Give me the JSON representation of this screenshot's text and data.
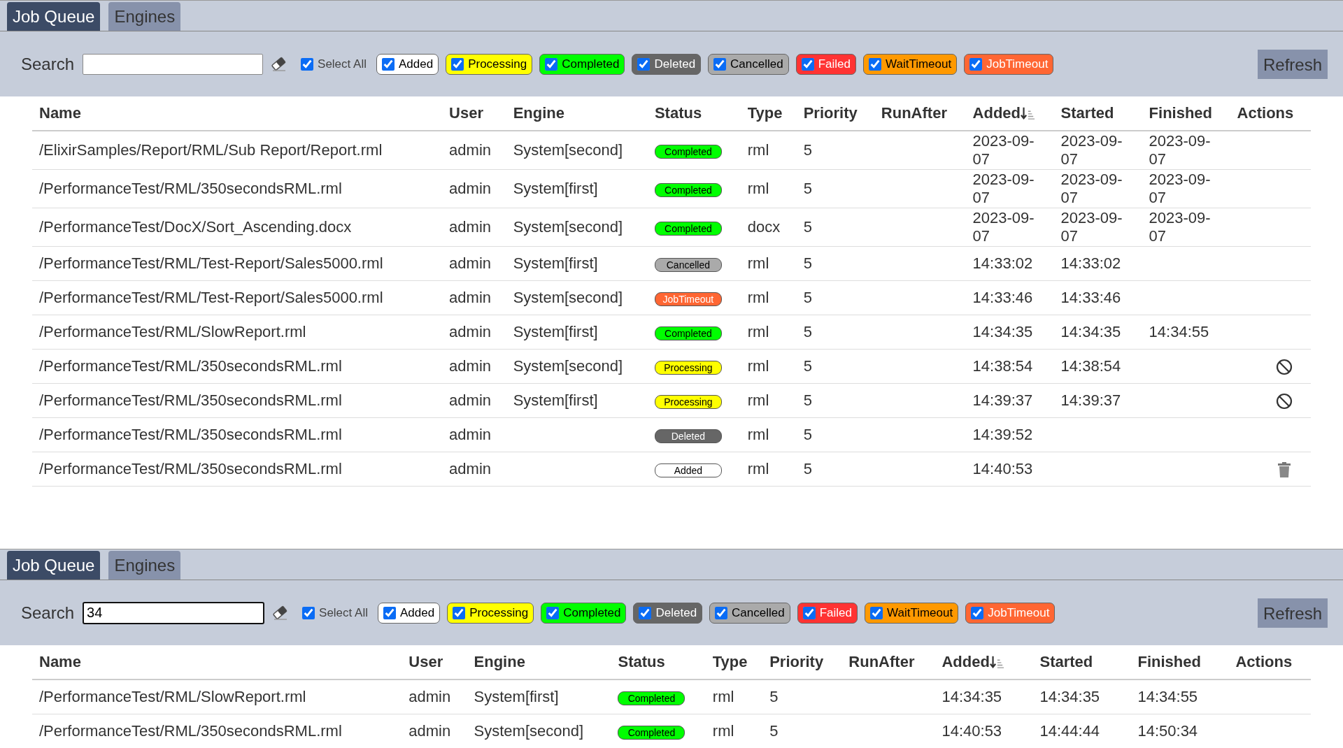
{
  "panels": [
    {
      "tabs": [
        {
          "label": "Job Queue",
          "selected": true
        },
        {
          "label": "Engines",
          "selected": false
        }
      ],
      "search": {
        "label": "Search"
      },
      "select_all": {
        "label": "Select All",
        "checked": true
      },
      "filters": [
        {
          "label": "Added",
          "checked": true,
          "color": "#ffffff"
        },
        {
          "label": "Processing",
          "checked": true,
          "color": "#ffff00"
        },
        {
          "label": "Completed",
          "checked": true,
          "color": "#00ff00"
        },
        {
          "label": "Deleted",
          "checked": true,
          "color": "#666666"
        },
        {
          "label": "Cancelled",
          "checked": true,
          "color": "#aaaaaa"
        },
        {
          "label": "Failed",
          "checked": true,
          "color": "#ff3333"
        },
        {
          "label": "WaitTimeout",
          "checked": true,
          "color": "#ff9900"
        },
        {
          "label": "JobTimeout",
          "checked": true,
          "color": "#ff6633"
        }
      ],
      "refresh": "Refresh",
      "table": {
        "columns": [
          {
            "label": "Name",
            "sorted": false
          },
          {
            "label": "User",
            "sorted": false
          },
          {
            "label": "Engine",
            "sorted": false
          },
          {
            "label": "Status",
            "sorted": false
          },
          {
            "label": "Type",
            "sorted": false
          },
          {
            "label": "Priority",
            "sorted": false
          },
          {
            "label": "RunAfter",
            "sorted": false
          },
          {
            "label": "Added",
            "sorted": true
          },
          {
            "label": "Started",
            "sorted": false
          },
          {
            "label": "Finished",
            "sorted": false
          },
          {
            "label": "Actions",
            "sorted": false
          }
        ],
        "rows": [
          {
            "name": "/ElixirSamples/Report/RML/Sub Report/Report.rml",
            "user": "admin",
            "engine": "System[second]",
            "status": "Completed",
            "color": "#00ff00",
            "type": "rml",
            "priority": "5",
            "added": "2023-09-07",
            "started": "2023-09-07",
            "finished": "2023-09-07"
          },
          {
            "name": "/PerformanceTest/RML/350secondsRML.rml",
            "user": "admin",
            "engine": "System[first]",
            "status": "Completed",
            "color": "#00ff00",
            "type": "rml",
            "priority": "5",
            "added": "2023-09-07",
            "started": "2023-09-07",
            "finished": "2023-09-07"
          },
          {
            "name": "/PerformanceTest/DocX/Sort_Ascending.docx",
            "user": "admin",
            "engine": "System[second]",
            "status": "Completed",
            "color": "#00ff00",
            "type": "docx",
            "priority": "5",
            "added": "2023-09-07",
            "started": "2023-09-07",
            "finished": "2023-09-07"
          },
          {
            "name": "/PerformanceTest/RML/Test-Report/Sales5000.rml",
            "user": "admin",
            "engine": "System[first]",
            "status": "Cancelled",
            "color": "#aaaaaa",
            "type": "rml",
            "priority": "5",
            "added": "14:33:02",
            "started": "14:33:02"
          },
          {
            "name": "/PerformanceTest/RML/Test-Report/Sales5000.rml",
            "user": "admin",
            "engine": "System[second]",
            "status": "JobTimeout",
            "color": "#ff6633",
            "type": "rml",
            "priority": "5",
            "added": "14:33:46",
            "started": "14:33:46"
          },
          {
            "name": "/PerformanceTest/RML/SlowReport.rml",
            "user": "admin",
            "engine": "System[first]",
            "status": "Completed",
            "color": "#00ff00",
            "type": "rml",
            "priority": "5",
            "added": "14:34:35",
            "started": "14:34:35",
            "finished": "14:34:55"
          },
          {
            "name": "/PerformanceTest/RML/350secondsRML.rml",
            "user": "admin",
            "engine": "System[second]",
            "status": "Processing",
            "color": "#ffff00",
            "type": "rml",
            "priority": "5",
            "added": "14:38:54",
            "started": "14:38:54",
            "action": {
              "kind": "cancel"
            }
          },
          {
            "name": "/PerformanceTest/RML/350secondsRML.rml",
            "user": "admin",
            "engine": "System[first]",
            "status": "Processing",
            "color": "#ffff00",
            "type": "rml",
            "priority": "5",
            "added": "14:39:37",
            "started": "14:39:37",
            "action": {
              "kind": "cancel"
            }
          },
          {
            "name": "/PerformanceTest/RML/350secondsRML.rml",
            "user": "admin",
            "status": "Deleted",
            "color": "#666666",
            "type": "rml",
            "priority": "5",
            "added": "14:39:52"
          },
          {
            "name": "/PerformanceTest/RML/350secondsRML.rml",
            "user": "admin",
            "status": "Added",
            "color": "#ffffff",
            "type": "rml",
            "priority": "5",
            "added": "14:40:53",
            "action": {
              "kind": "delete"
            }
          }
        ]
      }
    },
    {
      "tabs": [
        {
          "label": "Job Queue",
          "selected": true
        },
        {
          "label": "Engines",
          "selected": false
        }
      ],
      "search": {
        "label": "Search",
        "value": "34"
      },
      "select_all": {
        "label": "Select All",
        "checked": true
      },
      "filters": [
        {
          "label": "Added",
          "checked": true,
          "color": "#ffffff"
        },
        {
          "label": "Processing",
          "checked": true,
          "color": "#ffff00"
        },
        {
          "label": "Completed",
          "checked": true,
          "color": "#00ff00"
        },
        {
          "label": "Deleted",
          "checked": true,
          "color": "#666666"
        },
        {
          "label": "Cancelled",
          "checked": true,
          "color": "#aaaaaa"
        },
        {
          "label": "Failed",
          "checked": true,
          "color": "#ff3333"
        },
        {
          "label": "WaitTimeout",
          "checked": true,
          "color": "#ff9900"
        },
        {
          "label": "JobTimeout",
          "checked": true,
          "color": "#ff6633"
        }
      ],
      "refresh": "Refresh",
      "table": {
        "columns": [
          {
            "label": "Name",
            "sorted": false
          },
          {
            "label": "User",
            "sorted": false
          },
          {
            "label": "Engine",
            "sorted": false
          },
          {
            "label": "Status",
            "sorted": false
          },
          {
            "label": "Type",
            "sorted": false
          },
          {
            "label": "Priority",
            "sorted": false
          },
          {
            "label": "RunAfter",
            "sorted": false
          },
          {
            "label": "Added",
            "sorted": true
          },
          {
            "label": "Started",
            "sorted": false
          },
          {
            "label": "Finished",
            "sorted": false
          },
          {
            "label": "Actions",
            "sorted": false
          }
        ],
        "rows": [
          {
            "name": "/PerformanceTest/RML/SlowReport.rml",
            "user": "admin",
            "engine": "System[first]",
            "status": "Completed",
            "color": "#00ff00",
            "type": "rml",
            "priority": "5",
            "added": "14:34:35",
            "started": "14:34:35",
            "finished": "14:34:55"
          },
          {
            "name": "/PerformanceTest/RML/350secondsRML.rml",
            "user": "admin",
            "engine": "System[second]",
            "status": "Completed",
            "color": "#00ff00",
            "type": "rml",
            "priority": "5",
            "added": "14:40:53",
            "started": "14:44:44",
            "finished": "14:50:34"
          }
        ]
      }
    }
  ]
}
